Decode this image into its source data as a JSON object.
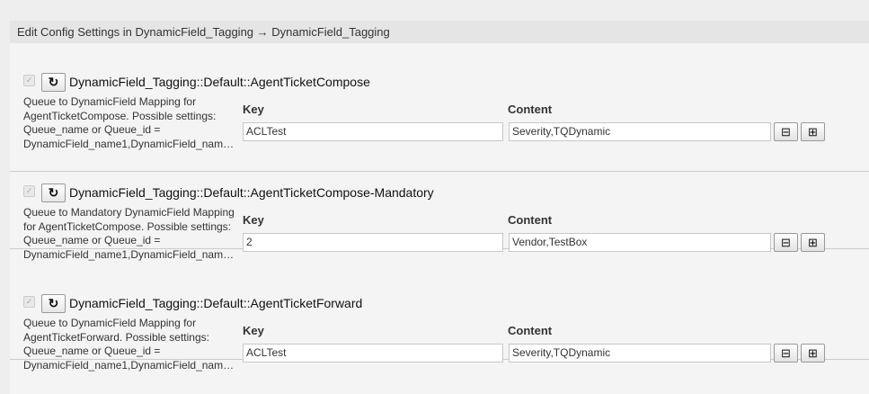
{
  "header": {
    "title": "Edit Config Settings in DynamicField_Tagging → DynamicField_Tagging"
  },
  "labels": {
    "key": "Key",
    "content": "Content"
  },
  "icons": {
    "reset": "↻",
    "remove": "⊟",
    "add": "⊞",
    "check": "✓"
  },
  "settings": [
    {
      "name": "DynamicField_Tagging::Default::AgentTicketCompose",
      "description": [
        "Queue to DynamicField Mapping for",
        "AgentTicketCompose. Possible settings:",
        "Queue_name or Queue_id =",
        "DynamicField_name1,DynamicField_nam…"
      ],
      "key": "ACLTest",
      "content": "Severity,TQDynamic"
    },
    {
      "name": "DynamicField_Tagging::Default::AgentTicketCompose-Mandatory",
      "description": [
        "Queue to Mandatory DynamicField Mapping",
        "for AgentTicketCompose. Possible settings:",
        "Queue_name or Queue_id =",
        "DynamicField_name1,DynamicField_nam…"
      ],
      "key": "2",
      "content": "Vendor,TestBox"
    },
    {
      "name": "DynamicField_Tagging::Default::AgentTicketForward",
      "description": [
        "Queue to DynamicField Mapping for",
        "AgentTicketForward. Possible settings:",
        "Queue_name or Queue_id =",
        "DynamicField_name1,DynamicField_nam…"
      ],
      "key": "ACLTest",
      "content": "Severity,TQDynamic"
    }
  ]
}
